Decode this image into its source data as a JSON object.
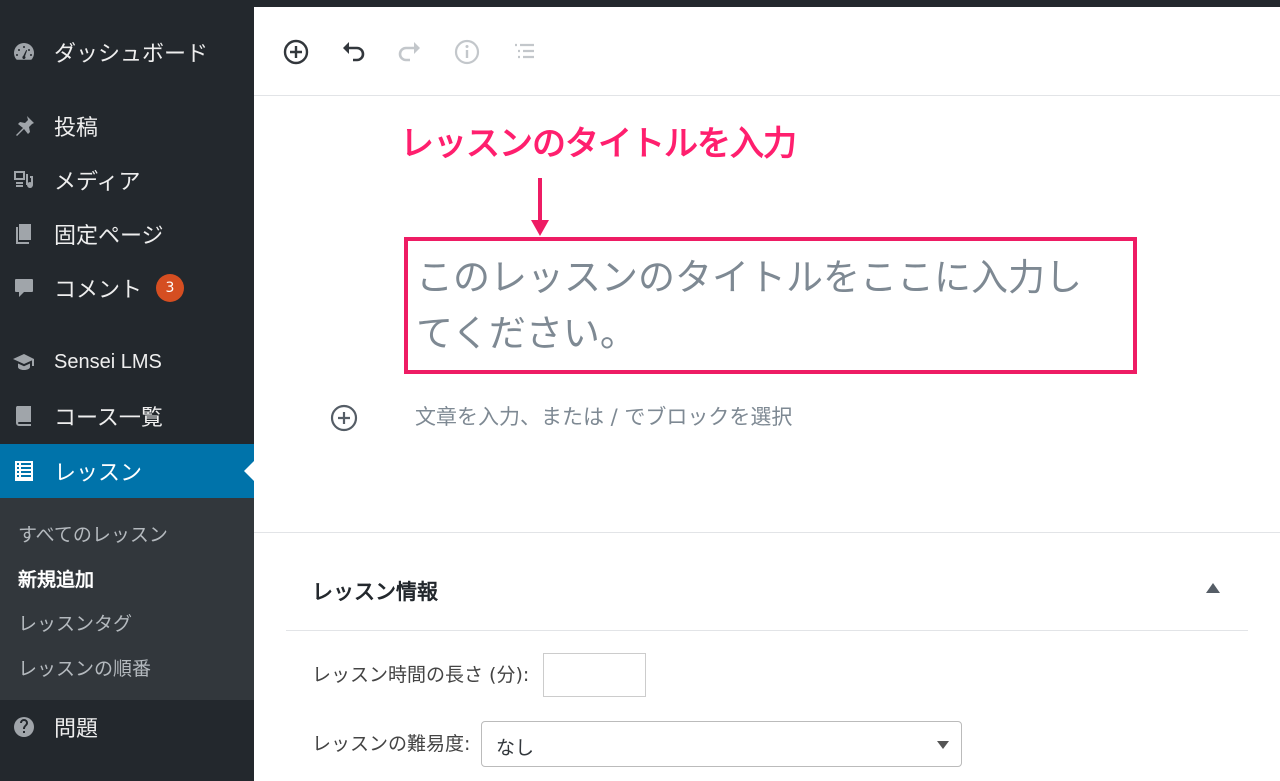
{
  "sidebar": {
    "menu": [
      {
        "label": "ダッシュボード",
        "icon": "dashboard-icon"
      },
      {
        "label": "投稿",
        "icon": "pin-icon"
      },
      {
        "label": "メディア",
        "icon": "media-icon"
      },
      {
        "label": "固定ページ",
        "icon": "page-icon"
      },
      {
        "label": "コメント",
        "icon": "comment-icon",
        "badge": "3"
      },
      {
        "label": "Sensei LMS",
        "icon": "graduation-cap-icon"
      },
      {
        "label": "コース一覧",
        "icon": "book-icon"
      },
      {
        "label": "レッスン",
        "icon": "list-icon"
      },
      {
        "label": "問題",
        "icon": "question-icon"
      }
    ],
    "submenu": [
      "すべてのレッスン",
      "新規追加",
      "レッスンタグ",
      "レッスンの順番"
    ],
    "current_submenu": "新規追加"
  },
  "toolbar": {
    "buttons": [
      "add-block-icon",
      "undo-icon",
      "redo-icon",
      "info-icon",
      "outline-icon"
    ]
  },
  "annotation": {
    "label": "レッスンのタイトルを入力",
    "color": "#ee1c64"
  },
  "editor": {
    "title_placeholder": "このレッスンのタイトルをここに入力してください。",
    "paragraph_placeholder": "文章を入力、または / でブロックを選択"
  },
  "lesson_panel": {
    "title": "レッスン情報",
    "length_label": "レッスン時間の長さ (分):",
    "length_value": "",
    "difficulty_label": "レッスンの難易度:",
    "difficulty_value": "なし"
  },
  "colors": {
    "sidebar_bg": "#23282d",
    "submenu_bg": "#32373c",
    "active_bg": "#0073aa",
    "badge_bg": "#d54e21"
  }
}
